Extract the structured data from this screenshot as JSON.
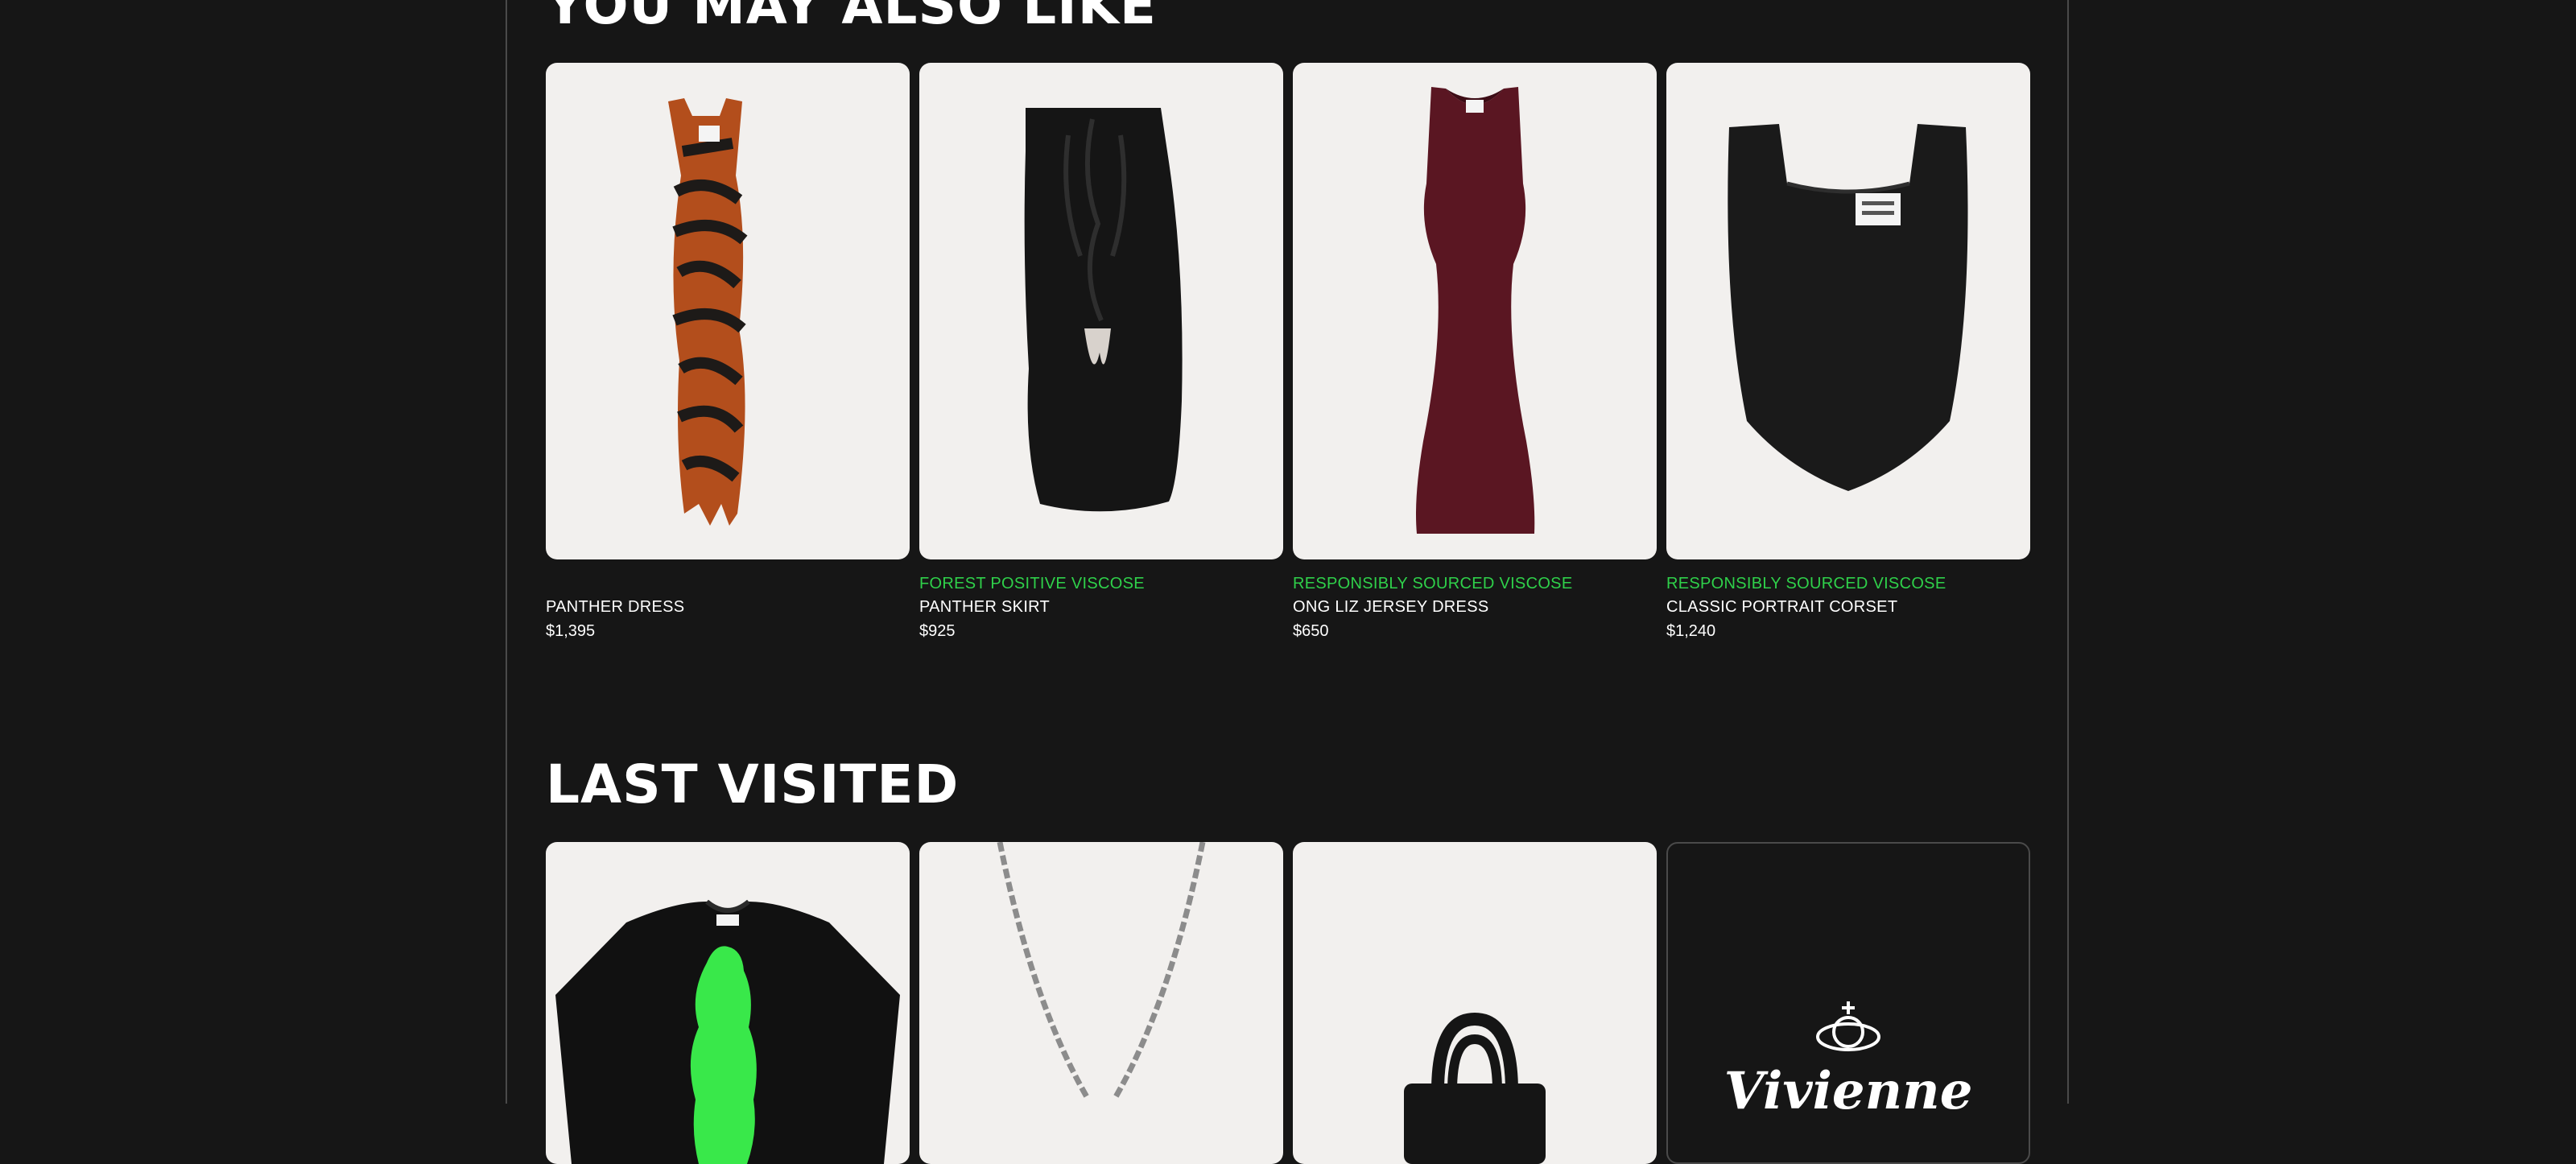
{
  "sections": {
    "also_like_title": "YOU MAY ALSO LIKE",
    "last_visited_title": "LAST VISITED"
  },
  "recommendations": [
    {
      "tag": "",
      "name": "PANTHER DRESS",
      "price": "$1,395"
    },
    {
      "tag": "FOREST POSITIVE VISCOSE",
      "name": "PANTHER SKIRT",
      "price": "$925"
    },
    {
      "tag": "RESPONSIBLY SOURCED VISCOSE",
      "name": "ONG LIZ JERSEY DRESS",
      "price": "$650"
    },
    {
      "tag": "RESPONSIBLY SOURCED VISCOSE",
      "name": "CLASSIC PORTRAIT CORSET",
      "price": "$1,240"
    }
  ],
  "last_visited_logo": "Vivienne",
  "colors": {
    "background": "#161616",
    "card_background": "#f2f0ee",
    "tag_green": "#2fd04a",
    "border": "#4a4a4a"
  }
}
